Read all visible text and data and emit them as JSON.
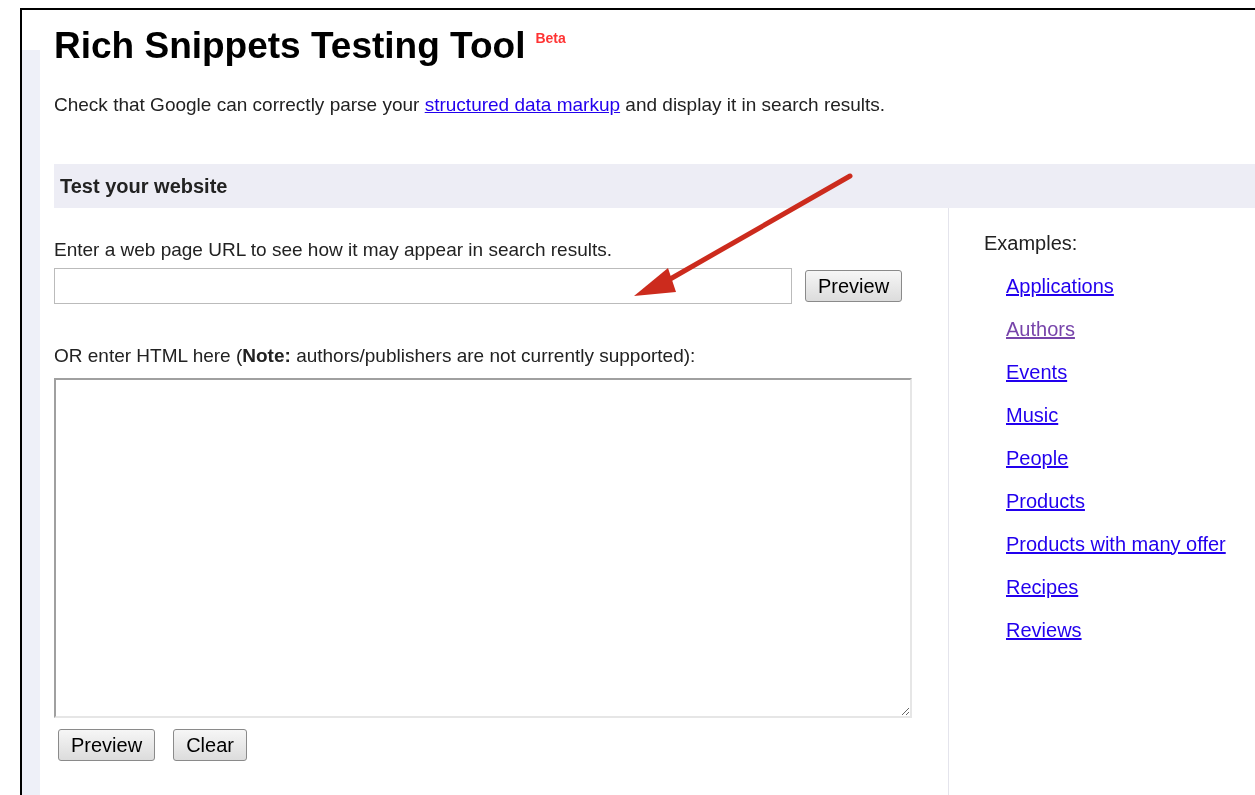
{
  "header": {
    "title": "Rich Snippets Testing Tool",
    "badge": "Beta"
  },
  "intro": {
    "before": "Check that Google can correctly parse your",
    "link": "structured data markup",
    "after": "and display it in search results."
  },
  "section": {
    "title": "Test your website"
  },
  "url_form": {
    "label": "Enter a web page URL to see how it may appear in search results.",
    "button": "Preview"
  },
  "html_form": {
    "label": "OR enter HTML here (**Note:** authors/publishers are not currently supported):",
    "buttons": [
      "Preview",
      "Clear"
    ]
  },
  "examples": {
    "title": "Examples:",
    "links": [
      {
        "label": "Applications",
        "visited": false
      },
      {
        "label": "Authors",
        "visited": true
      },
      {
        "label": "Events",
        "visited": false
      },
      {
        "label": "Music",
        "visited": false
      },
      {
        "label": "People",
        "visited": false
      },
      {
        "label": "Products",
        "visited": false
      },
      {
        "label": "Products with many offer",
        "visited": false
      },
      {
        "label": "Recipes",
        "visited": false
      },
      {
        "label": "Reviews",
        "visited": false
      }
    ]
  }
}
